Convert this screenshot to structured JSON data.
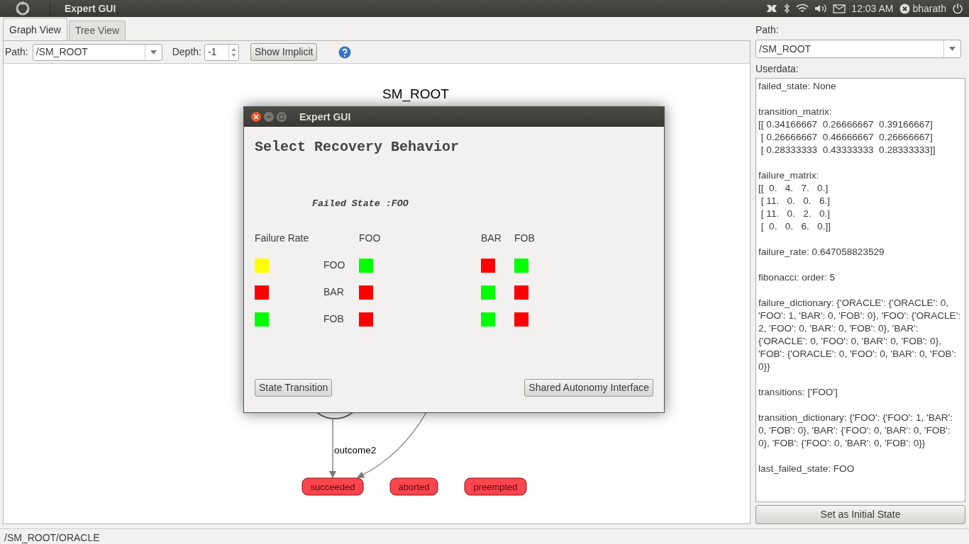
{
  "top_panel": {
    "app_title": "Expert GUI",
    "clock": "12:03 AM",
    "user": "bharath"
  },
  "tabs": [
    {
      "label": "Graph View",
      "selected": true
    },
    {
      "label": "Tree View",
      "selected": false
    }
  ],
  "toolbar": {
    "path_label": "Path:",
    "path_value": "/SM_ROOT",
    "depth_label": "Depth:",
    "depth_value": "-1",
    "show_implicit": "Show Implicit"
  },
  "graph": {
    "title": "SM_ROOT",
    "edge_label": "outcome2",
    "outcomes": [
      "succeeded",
      "aborted",
      "preempted"
    ]
  },
  "dialog": {
    "title": "Expert GUI",
    "heading": "Select Recovery Behavior",
    "failed_state": "Failed State :FOO",
    "rate_header": "Failure Rate",
    "columns": [
      "FOO",
      "BAR",
      "FOB"
    ],
    "rows": [
      {
        "label": "FOO",
        "rate": {
          "color": "#ffff00"
        },
        "cells": [
          {
            "color": "#00ff00"
          },
          {
            "color": "#ff0000"
          },
          {
            "color": "#00ff00"
          }
        ]
      },
      {
        "label": "BAR",
        "rate": {
          "color": "#ff0000"
        },
        "cells": [
          {
            "color": "#ff0000"
          },
          {
            "color": "#00ff00"
          },
          {
            "color": "#ff0000"
          }
        ]
      },
      {
        "label": "FOB",
        "rate": {
          "color": "#00ff00"
        },
        "cells": [
          {
            "color": "#ff0000"
          },
          {
            "color": "#00ff00"
          },
          {
            "color": "#ff0000"
          }
        ]
      }
    ],
    "buttons": [
      "State Transition",
      "Shared Autonomy Interface"
    ]
  },
  "side": {
    "path_label": "Path:",
    "path_value": "/SM_ROOT",
    "userdata_label": "Userdata:",
    "userdata": [
      [
        "failed_state: None"
      ],
      [
        "transition_matrix:",
        "[[ 0.34166667  0.26666667  0.39166667]",
        " [ 0.26666667  0.46666667  0.26666667]",
        " [ 0.28333333  0.43333333  0.28333333]]"
      ],
      [
        "failure_matrix:",
        "[[  0.   4.   7.   0.]",
        " [ 11.   0.   0.   6.]",
        " [ 11.   0.   2.   0.]",
        " [  0.   0.   6.   0.]]"
      ],
      [
        "failure_rate: 0.647058823529"
      ],
      [
        "fibonacci: order: 5"
      ],
      [
        "failure_dictionary: {'ORACLE': {'ORACLE': 0, 'FOO': 1, 'BAR': 0, 'FOB': 0}, 'FOO': {'ORACLE': 2, 'FOO': 0, 'BAR': 0, 'FOB': 0}, 'BAR': {'ORACLE': 0, 'FOO': 0, 'BAR': 0, 'FOB': 0}, 'FOB': {'ORACLE': 0, 'FOO': 0, 'BAR': 0, 'FOB': 0}}"
      ],
      [
        "transitions: ['FOO']"
      ],
      [
        "transition_dictionary: {'FOO': {'FOO': 1, 'BAR': 0, 'FOB': 0}, 'BAR': {'FOO': 0, 'BAR': 0, 'FOB': 0}, 'FOB': {'FOO': 0, 'BAR': 0, 'FOB': 0}}"
      ],
      [
        "last_failed_state: FOO"
      ]
    ],
    "button": "Set as Initial State"
  },
  "status_bar": "/SM_ROOT/ORACLE"
}
